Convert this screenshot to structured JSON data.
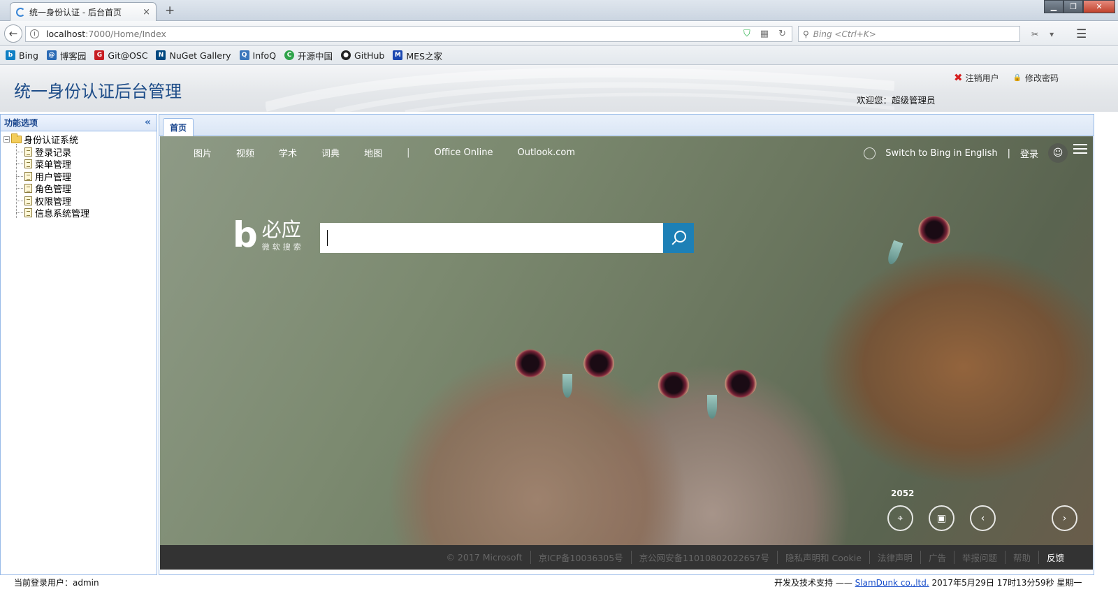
{
  "browser": {
    "tab_title": "统一身份认证 - 后台首页",
    "tab_close": "×",
    "new_tab": "+",
    "url_host": "localhost",
    "url_path": ":7000/Home/Index",
    "search_placeholder": "Bing <Ctrl+K>",
    "bookmarks": [
      {
        "label": "Bing",
        "icon": "bing-icon",
        "color": "#0f7fc4"
      },
      {
        "label": "博客园",
        "icon": "cnblogs-icon",
        "color": "#2a6ab5"
      },
      {
        "label": "Git@OSC",
        "icon": "gitosc-icon",
        "color": "#c71d23"
      },
      {
        "label": "NuGet Gallery",
        "icon": "nuget-icon",
        "color": "#004880"
      },
      {
        "label": "InfoQ",
        "icon": "infoq-icon",
        "color": "#3b77bc"
      },
      {
        "label": "开源中国",
        "icon": "oschina-icon",
        "color": "#2fa34a"
      },
      {
        "label": "GitHub",
        "icon": "github-icon",
        "color": "#222222"
      },
      {
        "label": "MES之家",
        "icon": "mes-icon",
        "color": "#1a47b0"
      }
    ]
  },
  "header": {
    "title": "统一身份认证后台管理",
    "logout": "注销用户",
    "change_password": "修改密码",
    "welcome": "欢迎您：超级管理员"
  },
  "sidebar": {
    "title": "功能选项",
    "collapse": "«",
    "root": "身份认证系统",
    "items": [
      "登录记录",
      "菜单管理",
      "用户管理",
      "角色管理",
      "权限管理",
      "信息系统管理"
    ]
  },
  "main": {
    "tab": "首页"
  },
  "bing": {
    "nav": [
      "图片",
      "视频",
      "学术",
      "词典",
      "地图"
    ],
    "nav_sep": "|",
    "nav_extra": [
      "Office Online",
      "Outlook.com"
    ],
    "switch_lang": "Switch to Bing in English",
    "right_sep": "|",
    "login": "登录",
    "logo_cn": "必应",
    "logo_sub": "微软搜索",
    "count": "2052",
    "footer": [
      "© 2017 Microsoft",
      "京ICP备10036305号",
      "京公网安备11010802022657号",
      "隐私声明和 Cookie",
      "法律声明",
      "广告",
      "举报问题",
      "帮助",
      "反馈"
    ]
  },
  "status": {
    "current_user": "当前登录用户：admin",
    "support_prefix": "开发及技术支持 ——",
    "company": "SlamDunk co.,ltd.",
    "datetime": "2017年5月29日 17时13分59秒 星期一"
  }
}
